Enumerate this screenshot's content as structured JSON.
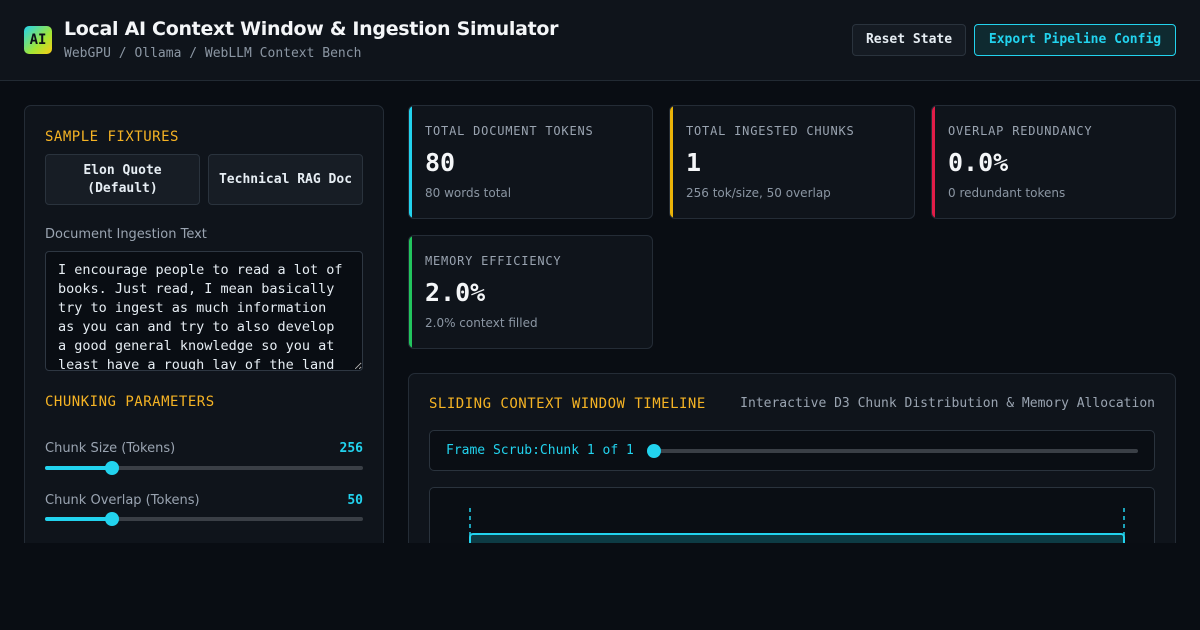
{
  "header": {
    "logo_text": "AI",
    "title": "Local AI Context Window & Ingestion Simulator",
    "subtitle": "WebGPU / Ollama / WebLLM Context Bench",
    "reset_label": "Reset State",
    "export_label": "Export Pipeline Config"
  },
  "sidebar": {
    "fixtures_heading": "SAMPLE FIXTURES",
    "fixtures": [
      {
        "label": "Elon Quote (Default)"
      },
      {
        "label": "Technical RAG Doc"
      }
    ],
    "doc_label": "Document Ingestion Text",
    "doc_text": "I encourage people to read a lot of books. Just read, I mean basically try to ingest as much information as you can and try to also develop a good general knowledge so you at least have a rough lay of the land",
    "chunking_heading": "CHUNKING PARAMETERS",
    "chunk_size": {
      "label": "Chunk Size (Tokens)",
      "value": "256",
      "fraction": 0.21
    },
    "chunk_overlap": {
      "label": "Chunk Overlap (Tokens)",
      "value": "50",
      "fraction": 0.21
    }
  },
  "stats": [
    {
      "label": "TOTAL DOCUMENT TOKENS",
      "value": "80",
      "sub": "80 words total",
      "color": "#22d3ee"
    },
    {
      "label": "TOTAL INGESTED CHUNKS",
      "value": "1",
      "sub": "256 tok/size, 50 overlap",
      "color": "#eab308"
    },
    {
      "label": "OVERLAP REDUNDANCY",
      "value": "0.0%",
      "sub": "0 redundant tokens",
      "color": "#e11d48"
    },
    {
      "label": "MEMORY EFFICIENCY",
      "value": "2.0%",
      "sub": "2.0% context filled",
      "color": "#22c55e"
    }
  ],
  "timeline": {
    "title": "SLIDING CONTEXT WINDOW TIMELINE",
    "subtitle": "Interactive D3 Chunk Distribution & Memory Allocation",
    "scrub_label": "Frame Scrub:Chunk 1 of 1",
    "scrub_fraction": 0,
    "chunk_color": "#22d3ee"
  }
}
